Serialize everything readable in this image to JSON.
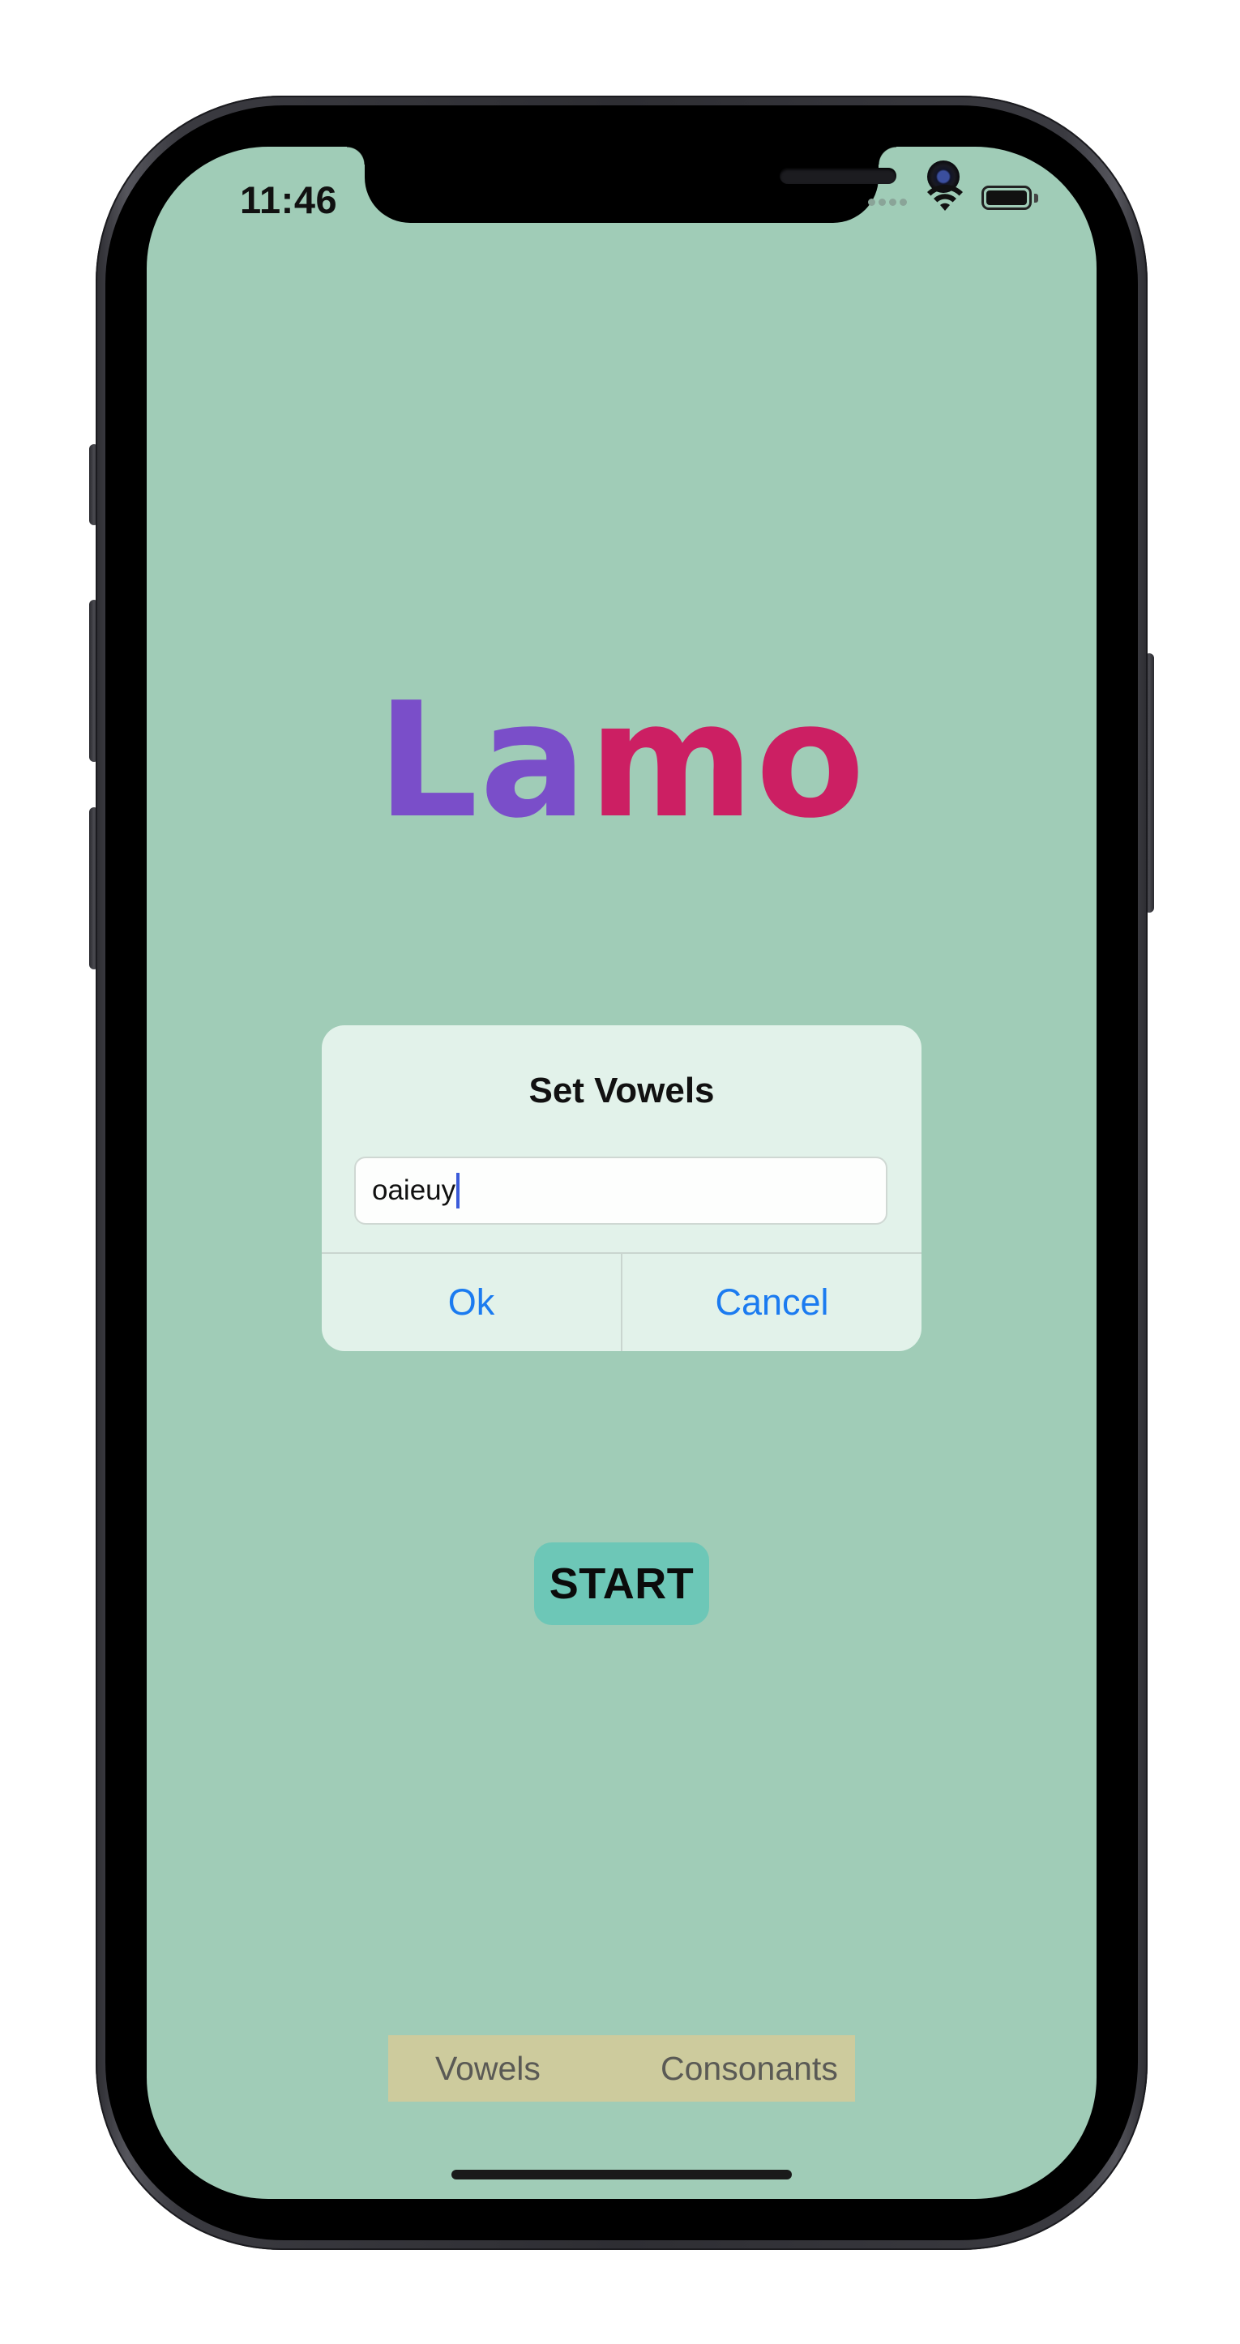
{
  "status_bar": {
    "time": "11:46"
  },
  "app": {
    "logo_letters": [
      {
        "char": "L",
        "color": "#7a4ec9"
      },
      {
        "char": "a",
        "color": "#7a4ec9"
      },
      {
        "char": "m",
        "color": "#cc1f63"
      },
      {
        "char": "o",
        "color": "#cc1f63"
      }
    ]
  },
  "alert": {
    "title": "Set Vowels",
    "input_value": "oaieuy",
    "ok_label": "Ok",
    "cancel_label": "Cancel"
  },
  "start_button": {
    "label": "START"
  },
  "bottom_tabs": [
    {
      "label": "Vowels"
    },
    {
      "label": "Consonants"
    }
  ],
  "colors": {
    "screen_background": "#a0ccb7",
    "alert_background": "#e2f2ea",
    "link_blue": "#1b7bf0",
    "start_button": "#6dc7b7",
    "segmented_background": "#cdcb9d"
  },
  "icons": [
    "cellular-signal-icon",
    "wifi-icon",
    "battery-icon"
  ]
}
